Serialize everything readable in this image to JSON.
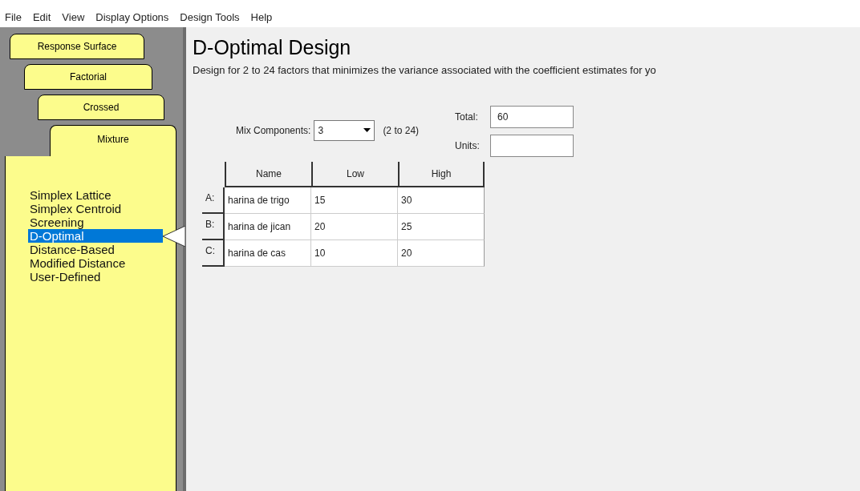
{
  "menu": [
    "File",
    "Edit",
    "View",
    "Display Options",
    "Design Tools",
    "Help"
  ],
  "tabs": [
    {
      "label": "Response Surface",
      "selected": false
    },
    {
      "label": "Factorial",
      "selected": false
    },
    {
      "label": "Crossed",
      "selected": false
    },
    {
      "label": "Mixture",
      "selected": true
    }
  ],
  "design_list": [
    {
      "label": "Simplex Lattice",
      "selected": false
    },
    {
      "label": "Simplex Centroid",
      "selected": false
    },
    {
      "label": "Screening",
      "selected": false
    },
    {
      "label": "D-Optimal",
      "selected": true
    },
    {
      "label": "Distance-Based",
      "selected": false
    },
    {
      "label": "Modified Distance",
      "selected": false
    },
    {
      "label": "User-Defined",
      "selected": false
    }
  ],
  "title": "D-Optimal Design",
  "description": "Design for 2 to 24 factors that minimizes the variance associated with the coefficient estimates for yo",
  "mix_components": {
    "label": "Mix Components:",
    "value": "3",
    "range": "(2 to 24)"
  },
  "total": {
    "label": "Total:",
    "value": "60"
  },
  "units": {
    "label": "Units:"
  },
  "table": {
    "columns": [
      "Name",
      "Low",
      "High"
    ],
    "rows": [
      {
        "label": "A:",
        "cells": [
          "harina de trigo",
          "15",
          "30"
        ]
      },
      {
        "label": "B:",
        "cells": [
          "harina de jican",
          "20",
          "25"
        ]
      },
      {
        "label": "C:",
        "cells": [
          "harina de cas",
          "10",
          "20"
        ]
      }
    ]
  }
}
